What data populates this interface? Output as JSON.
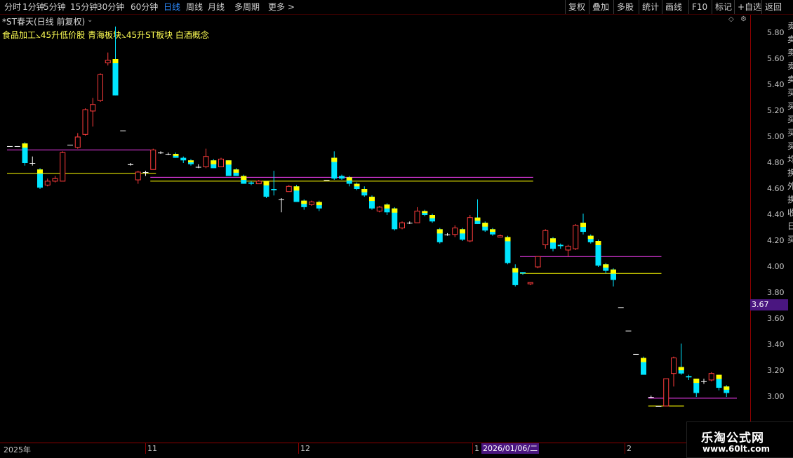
{
  "toolbar": {
    "left_items": [
      "分时",
      "1分钟",
      "5分钟",
      "15分钟",
      "30分钟",
      "60分钟",
      "日线",
      "周线",
      "月线",
      "多周期",
      "更多 >"
    ],
    "active": "日线",
    "right_items": [
      "复权",
      "叠加",
      "多股",
      "统计",
      "画线",
      "F10",
      "标记",
      "+自选",
      "返回"
    ]
  },
  "stock": {
    "title": "*ST春天(日线 前复权)",
    "tags": "食品加工⦣45升低价股 青海板块⦣45升ST板块 白酒概念"
  },
  "price_axis": {
    "labels": [
      "5.80",
      "5.60",
      "5.40",
      "5.20",
      "5.00",
      "4.80",
      "4.60",
      "4.40",
      "4.20",
      "4.00",
      "3.80",
      "3.60",
      "3.40",
      "3.20",
      "3.00"
    ],
    "current_price": "3.67"
  },
  "date_axis": {
    "labels": [
      "2025年",
      "11",
      "12",
      "1",
      "2"
    ],
    "cursor_date": "2026/01/06/二"
  },
  "right_panel": {
    "chars": [
      "卖",
      "卖",
      "卖",
      "卖",
      "卖",
      "买",
      "买",
      "买",
      "买",
      "买",
      "均",
      "换",
      "外",
      "换",
      "收",
      "日",
      "买"
    ]
  },
  "watermark": {
    "title": "乐淘公式网",
    "url": "www.60lt.com"
  },
  "colors": {
    "up": "#ff3c3c",
    "down": "#00e5ff",
    "yellow": "#ffff00",
    "magenta": "#ff40ff",
    "axis": "#8b0000"
  },
  "chart_data": {
    "type": "candlestick",
    "y_unit": "price",
    "ylim": [
      2.92,
      5.95
    ],
    "candles": [
      [
        4.93,
        4.93,
        4.93,
        4.93
      ],
      [
        4.93,
        4.93,
        4.93,
        4.93
      ],
      [
        4.95,
        4.8,
        4.96,
        4.78
      ],
      [
        4.8,
        4.8,
        4.85,
        4.78
      ],
      [
        4.75,
        4.61,
        4.76,
        4.6
      ],
      [
        4.63,
        4.66,
        4.68,
        4.62
      ],
      [
        4.66,
        4.68,
        4.7,
        4.65
      ],
      [
        4.66,
        4.88,
        4.89,
        4.66
      ],
      [
        4.94,
        4.94,
        4.94,
        4.94
      ],
      [
        4.92,
        5.0,
        5.03,
        4.91
      ],
      [
        5.02,
        5.21,
        5.22,
        5.01
      ],
      [
        5.2,
        5.25,
        5.3,
        5.08
      ],
      [
        5.28,
        5.48,
        5.49,
        5.27
      ],
      [
        5.57,
        5.59,
        5.65,
        5.55
      ],
      [
        5.6,
        5.32,
        5.85,
        5.32
      ],
      [
        5.05,
        5.05,
        5.05,
        5.05
      ],
      [
        4.79,
        4.79,
        4.8,
        4.78
      ],
      [
        4.67,
        4.73,
        4.74,
        4.64
      ],
      [
        4.73,
        4.73,
        4.74,
        4.7
      ],
      [
        4.75,
        4.9,
        4.91,
        4.75
      ],
      [
        4.88,
        4.88,
        4.89,
        4.87
      ],
      [
        4.87,
        4.87,
        4.88,
        4.86
      ],
      [
        4.87,
        4.84,
        4.88,
        4.84
      ],
      [
        4.84,
        4.82,
        4.85,
        4.8
      ],
      [
        4.82,
        4.79,
        4.83,
        4.78
      ],
      [
        4.77,
        4.77,
        4.79,
        4.76
      ],
      [
        4.77,
        4.85,
        4.91,
        4.76
      ],
      [
        4.82,
        4.76,
        4.83,
        4.76
      ],
      [
        4.77,
        4.83,
        4.84,
        4.77
      ],
      [
        4.82,
        4.7,
        4.82,
        4.7
      ],
      [
        4.75,
        4.7,
        4.76,
        4.7
      ],
      [
        4.7,
        4.64,
        4.71,
        4.64
      ],
      [
        4.65,
        4.64,
        4.66,
        4.63
      ],
      [
        4.64,
        4.66,
        4.67,
        4.64
      ],
      [
        4.66,
        4.54,
        4.66,
        4.53
      ],
      [
        4.6,
        4.59,
        4.74,
        4.55
      ],
      [
        4.52,
        4.52,
        4.53,
        4.42
      ],
      [
        4.58,
        4.62,
        4.63,
        4.58
      ],
      [
        4.62,
        4.5,
        4.63,
        4.5
      ],
      [
        4.51,
        4.46,
        4.52,
        4.44
      ],
      [
        4.48,
        4.5,
        4.51,
        4.47
      ],
      [
        4.5,
        4.45,
        4.51,
        4.43
      ],
      [
        4.67,
        4.67,
        4.67,
        4.67
      ],
      [
        4.84,
        4.68,
        4.89,
        4.67
      ],
      [
        4.7,
        4.68,
        4.71,
        4.67
      ],
      [
        4.69,
        4.64,
        4.7,
        4.62
      ],
      [
        4.64,
        4.6,
        4.65,
        4.59
      ],
      [
        4.6,
        4.55,
        4.62,
        4.54
      ],
      [
        4.54,
        4.45,
        4.55,
        4.44
      ],
      [
        4.43,
        4.46,
        4.47,
        4.42
      ],
      [
        4.48,
        4.42,
        4.49,
        4.4
      ],
      [
        4.45,
        4.29,
        4.46,
        4.28
      ],
      [
        4.3,
        4.34,
        4.35,
        4.29
      ],
      [
        4.34,
        4.34,
        4.35,
        4.33
      ],
      [
        4.34,
        4.43,
        4.46,
        4.34
      ],
      [
        4.43,
        4.4,
        4.44,
        4.39
      ],
      [
        4.4,
        4.35,
        4.41,
        4.34
      ],
      [
        4.29,
        4.19,
        4.3,
        4.18
      ],
      [
        4.25,
        4.25,
        4.26,
        4.24
      ],
      [
        4.25,
        4.3,
        4.32,
        4.23
      ],
      [
        4.29,
        4.21,
        4.3,
        4.2
      ],
      [
        4.2,
        4.38,
        4.4,
        4.19
      ],
      [
        4.38,
        4.33,
        4.52,
        4.33
      ],
      [
        4.34,
        4.28,
        4.35,
        4.27
      ],
      [
        4.29,
        4.25,
        4.3,
        4.24
      ],
      [
        4.23,
        4.24,
        4.25,
        4.23
      ],
      [
        4.23,
        4.03,
        4.24,
        4.02
      ],
      [
        3.99,
        3.86,
        4.02,
        3.85
      ],
      [
        3.96,
        3.95,
        3.96,
        3.94
      ],
      [
        3.87,
        3.88,
        3.88,
        3.86
      ],
      [
        4.0,
        4.08,
        4.08,
        3.99
      ],
      [
        4.17,
        4.28,
        4.29,
        4.14
      ],
      [
        4.22,
        4.14,
        4.23,
        4.12
      ],
      [
        4.17,
        4.16,
        4.18,
        4.14
      ],
      [
        4.13,
        4.16,
        4.17,
        4.08
      ],
      [
        4.14,
        4.32,
        4.33,
        4.13
      ],
      [
        4.34,
        4.27,
        4.41,
        4.25
      ],
      [
        4.24,
        4.19,
        4.25,
        4.18
      ],
      [
        4.2,
        4.01,
        4.21,
        4.0
      ],
      [
        4.02,
        3.97,
        4.03,
        3.95
      ],
      [
        3.98,
        3.9,
        3.99,
        3.85
      ],
      [
        3.69,
        3.69,
        3.69,
        3.69
      ],
      [
        3.51,
        3.51,
        3.51,
        3.51
      ],
      [
        3.33,
        3.33,
        3.33,
        3.33
      ],
      [
        3.3,
        3.17,
        3.31,
        3.17
      ],
      [
        3.0,
        3.0,
        3.01,
        2.99
      ],
      [
        2.93,
        2.93,
        2.93,
        2.93
      ],
      [
        2.93,
        3.14,
        3.14,
        2.93
      ],
      [
        3.18,
        3.3,
        3.31,
        3.08
      ],
      [
        3.23,
        3.18,
        3.41,
        3.17
      ],
      [
        3.16,
        3.15,
        3.17,
        3.13
      ],
      [
        3.14,
        3.03,
        3.14,
        3.0
      ],
      [
        3.12,
        3.12,
        3.14,
        3.1
      ],
      [
        3.13,
        3.18,
        3.19,
        3.12
      ],
      [
        3.17,
        3.07,
        3.17,
        3.05
      ],
      [
        3.08,
        3.03,
        3.09,
        3.0
      ]
    ],
    "hlines": [
      {
        "color": "magenta",
        "price": 4.9,
        "from": 0,
        "to": 19
      },
      {
        "color": "yellow",
        "price": 4.72,
        "from": 0,
        "to": 19
      },
      {
        "color": "magenta",
        "price": 4.69,
        "from": 19,
        "to": 69
      },
      {
        "color": "yellow",
        "price": 4.66,
        "from": 19,
        "to": 69
      },
      {
        "color": "magenta",
        "price": 4.08,
        "from": 68,
        "to": 86
      },
      {
        "color": "yellow",
        "price": 3.95,
        "from": 68,
        "to": 86
      },
      {
        "color": "magenta",
        "price": 2.99,
        "from": 85,
        "to": 96
      },
      {
        "color": "yellow",
        "price": 2.93,
        "from": 85,
        "to": 89
      }
    ]
  }
}
